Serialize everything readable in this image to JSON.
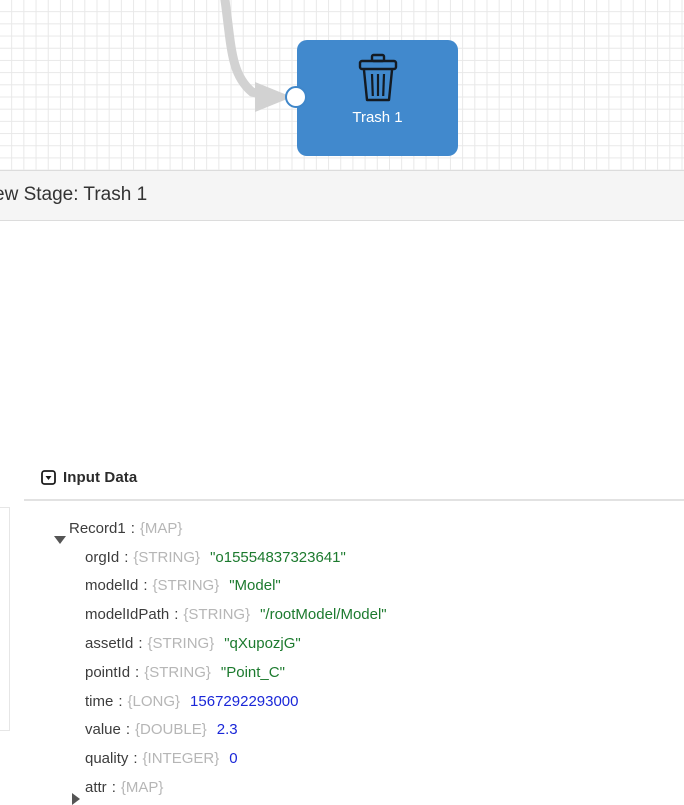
{
  "canvas": {
    "node": {
      "label": "Trash 1",
      "icon": "trash-icon",
      "color": "#4189cd",
      "port": "input-port"
    },
    "edge": {
      "name": "connector-edge",
      "arrow": "arrowhead"
    }
  },
  "header": {
    "title": "ew Stage: Trash 1"
  },
  "section": {
    "collapse_icon": "collapse-toggle-icon",
    "title": "Input Data"
  },
  "tree": {
    "rows": [
      {
        "toggle": "down",
        "indent": 0,
        "key": "Record1",
        "type": "{MAP}",
        "value": "",
        "value_kind": "none"
      },
      {
        "toggle": "none",
        "indent": 1,
        "key": "orgId",
        "type": "{STRING}",
        "value": "\"o15554837323641\"",
        "value_kind": "str"
      },
      {
        "toggle": "none",
        "indent": 1,
        "key": "modelId",
        "type": "{STRING}",
        "value": "\"Model\"",
        "value_kind": "str"
      },
      {
        "toggle": "none",
        "indent": 1,
        "key": "modelIdPath",
        "type": "{STRING}",
        "value": "\"/rootModel/Model\"",
        "value_kind": "str"
      },
      {
        "toggle": "none",
        "indent": 1,
        "key": "assetId",
        "type": "{STRING}",
        "value": "\"qXupozjG\"",
        "value_kind": "str"
      },
      {
        "toggle": "none",
        "indent": 1,
        "key": "pointId",
        "type": "{STRING}",
        "value": "\"Point_C\"",
        "value_kind": "str"
      },
      {
        "toggle": "none",
        "indent": 1,
        "key": "time",
        "type": "{LONG}",
        "value": "1567292293000",
        "value_kind": "num"
      },
      {
        "toggle": "none",
        "indent": 1,
        "key": "value",
        "type": "{DOUBLE}",
        "value": "2.3",
        "value_kind": "num"
      },
      {
        "toggle": "none",
        "indent": 1,
        "key": "quality",
        "type": "{INTEGER}",
        "value": "0",
        "value_kind": "num"
      },
      {
        "toggle": "right",
        "indent": 1,
        "key": "attr",
        "type": "{MAP}",
        "value": "",
        "value_kind": "none"
      }
    ]
  },
  "colors": {
    "node_blue": "#4189cd",
    "string_value": "#1c7a2e",
    "number_value": "#1a27d8",
    "type_gray": "#b6b6b6",
    "header_band": "#f5f5f5"
  }
}
